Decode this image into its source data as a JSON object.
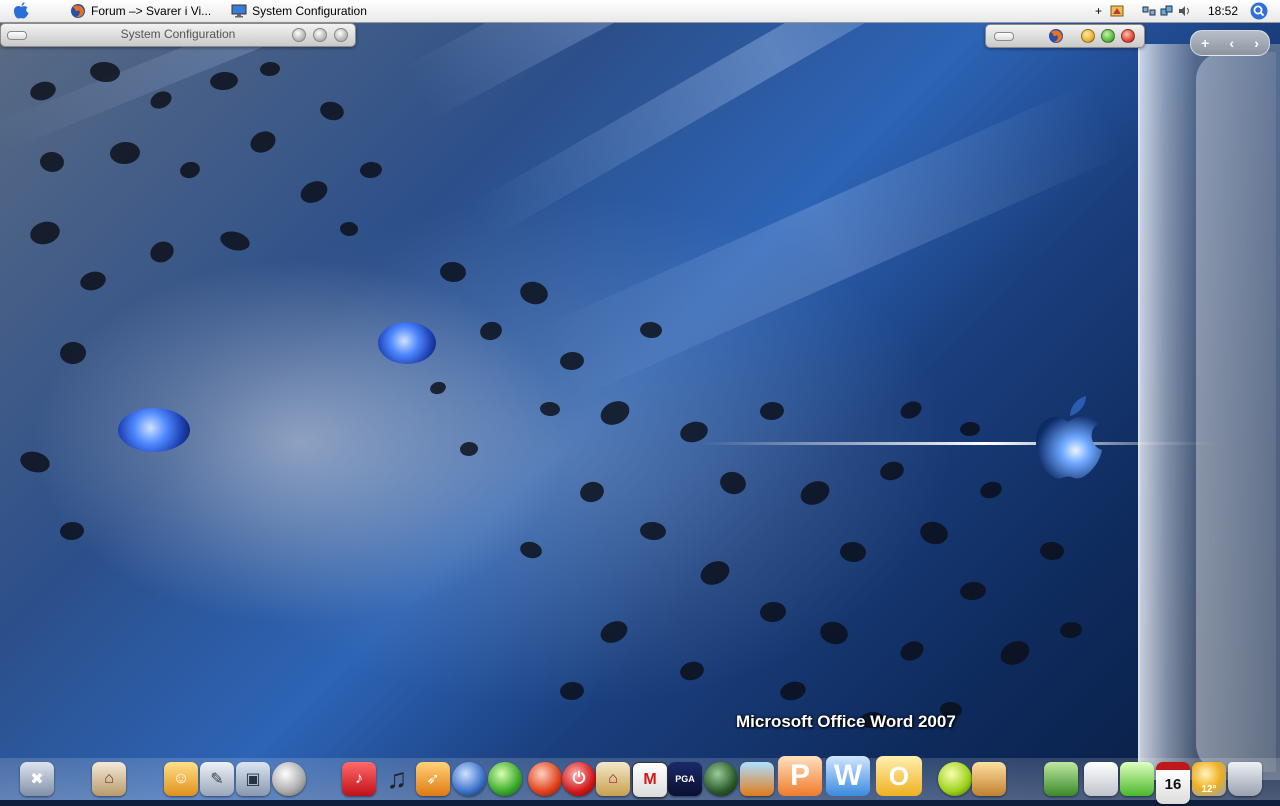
{
  "menubar": {
    "apple_icon": "apple-icon",
    "items": [
      {
        "label": "Forum –> Svarer i Vi...",
        "icon": "firefox-icon"
      },
      {
        "label": "System Configuration",
        "icon": "monitor-icon"
      }
    ],
    "tray": {
      "plus": "+",
      "clock": "18:52",
      "search_icon": "spotlight-search-icon"
    }
  },
  "windows": {
    "system_configuration": {
      "title": "System Configuration"
    },
    "browser": {
      "icon": "firefox-icon"
    }
  },
  "side_panel": {
    "add_label": "+",
    "prev_label": "‹",
    "next_label": "›"
  },
  "dock": {
    "hover_label": "Microsoft Office Word 2007",
    "calendar_day": "16",
    "weather_temp": "12°"
  },
  "colors": {
    "accent_blue": "#2d64b6",
    "menubar": "#f0f0f0",
    "close_red": "#e04a3a",
    "minimize_yellow": "#e7b33a",
    "zoom_green": "#5cbc3c"
  }
}
